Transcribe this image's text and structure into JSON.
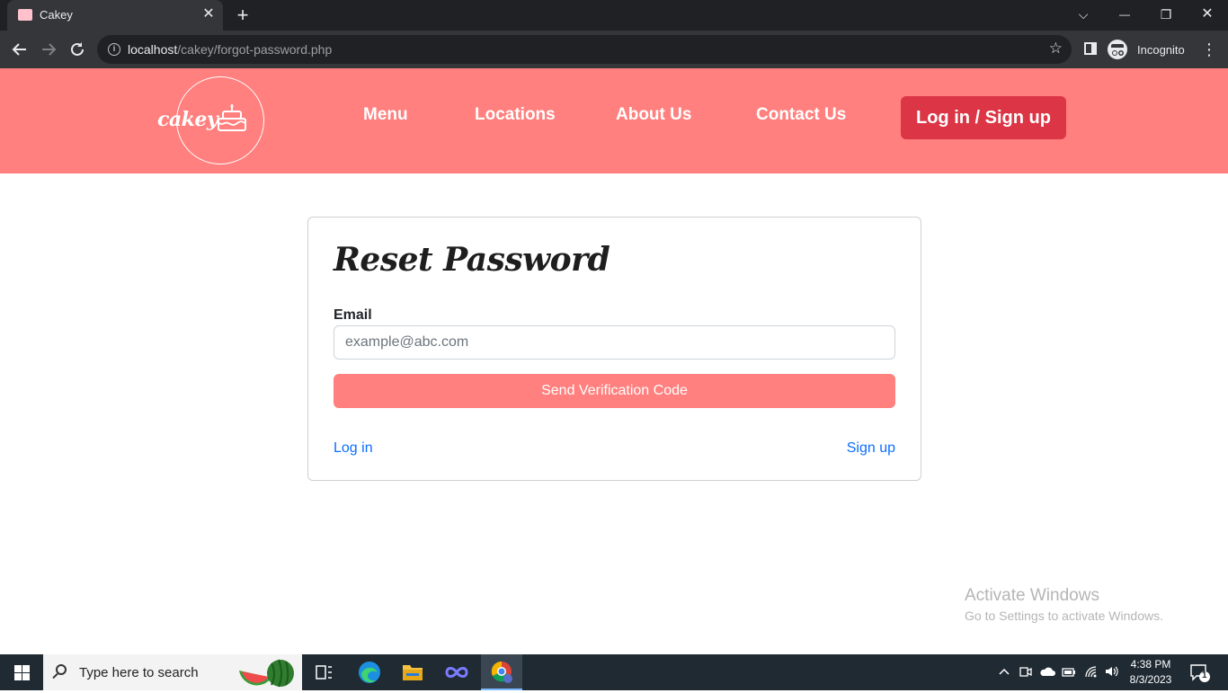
{
  "browser": {
    "tab_title": "Cakey",
    "tab_close": "✕",
    "new_tab": "+",
    "url_host": "localhost",
    "url_path": "/cakey/forgot-password.php",
    "incognito_label": "Incognito",
    "window_controls": {
      "tab_search": "⌵",
      "minimize": "—",
      "restore": "❐",
      "close": "✕"
    }
  },
  "site": {
    "logo_text": "cakey",
    "nav": [
      {
        "label": "Menu"
      },
      {
        "label": "Locations"
      },
      {
        "label": "About Us"
      },
      {
        "label": "Contact Us"
      }
    ],
    "login_button": "Log in / Sign up",
    "brand_color": "#ff807e",
    "accent_color": "#dc3545"
  },
  "form": {
    "title": "Reset Password",
    "email_label": "Email",
    "email_placeholder": "example@abc.com",
    "email_value": "",
    "submit_label": "Send Verification Code",
    "login_link": "Log in",
    "signup_link": "Sign up"
  },
  "watermark": {
    "title": "Activate Windows",
    "subtitle": "Go to Settings to activate Windows."
  },
  "taskbar": {
    "search_placeholder": "Type here to search",
    "time": "4:38 PM",
    "date": "8/3/2023",
    "notification_count": "1"
  }
}
